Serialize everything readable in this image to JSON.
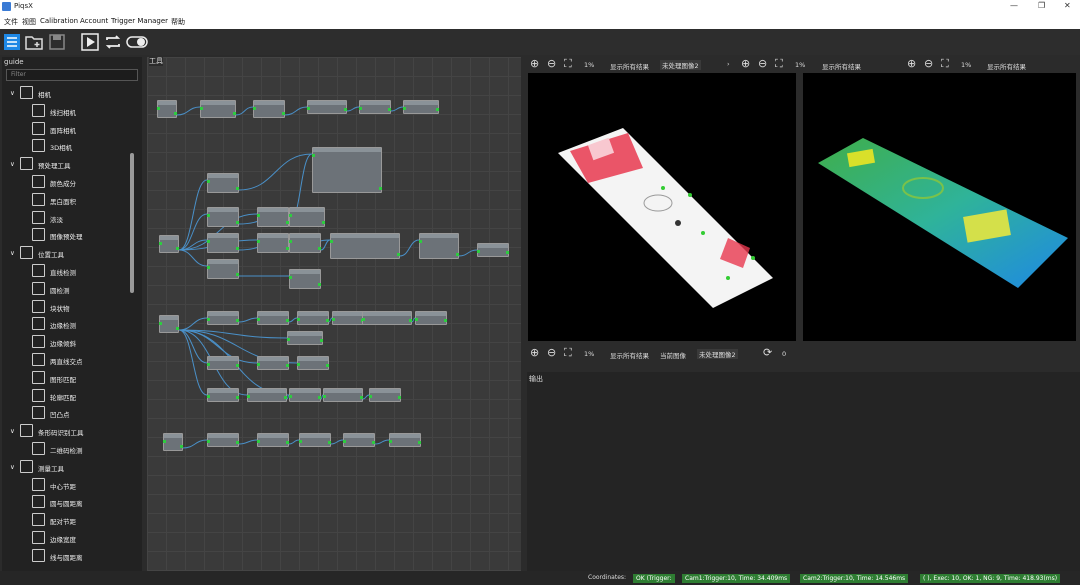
{
  "app": {
    "title": "PiqsX"
  },
  "window": {
    "minimize": "—",
    "maximize": "❐",
    "close": "✕"
  },
  "menu": [
    "文件",
    "视图",
    "Calibration",
    "Account",
    "Trigger Manager",
    "帮助"
  ],
  "left": {
    "header": "guide",
    "filter_placeholder": "Filter",
    "tree": [
      {
        "label": "相机",
        "level": 0
      },
      {
        "label": "线扫相机",
        "level": 1
      },
      {
        "label": "面阵相机",
        "level": 1
      },
      {
        "label": "3D相机",
        "level": 1
      },
      {
        "label": "预处理工具",
        "level": 0
      },
      {
        "label": "颜色成分",
        "level": 1
      },
      {
        "label": "黑白面积",
        "level": 1
      },
      {
        "label": "浓淡",
        "level": 1
      },
      {
        "label": "图像预处理",
        "level": 1
      },
      {
        "label": "位置工具",
        "level": 0
      },
      {
        "label": "直线检测",
        "level": 1
      },
      {
        "label": "圆检测",
        "level": 1
      },
      {
        "label": "块状物",
        "level": 1
      },
      {
        "label": "边缘检测",
        "level": 1
      },
      {
        "label": "边缘倾斜",
        "level": 1
      },
      {
        "label": "两直线交点",
        "level": 1
      },
      {
        "label": "图形匹配",
        "level": 1
      },
      {
        "label": "轮廓匹配",
        "level": 1
      },
      {
        "label": "凹凸点",
        "level": 1
      },
      {
        "label": "条形码识别工具",
        "level": 0
      },
      {
        "label": "二维码检测",
        "level": 1
      },
      {
        "label": "测量工具",
        "level": 0
      },
      {
        "label": "中心节距",
        "level": 1
      },
      {
        "label": "圆与圆距离",
        "level": 1
      },
      {
        "label": "配对节距",
        "level": 1
      },
      {
        "label": "边缘宽度",
        "level": 1
      },
      {
        "label": "线与圆距离",
        "level": 1
      }
    ]
  },
  "graph": {
    "header": "工具"
  },
  "viewer": {
    "zoom1": "1%",
    "show_all": "显示所有结果",
    "unproc": "未处理图像2",
    "current": "当前图像",
    "zoom_bottom": "1%",
    "count": "0"
  },
  "output": {
    "header": "输出"
  },
  "status": {
    "label": "Coordinates:",
    "items": [
      "OK (Trigger: ",
      "Cam1:Trigger:10, Time: 34.409ms ",
      "Cam2:Trigger:10, Time: 14.546ms ",
      "( ), Exec: 10, OK: 1, NG: 9, Time: 418.93(ms)"
    ]
  },
  "colors": {
    "accent": "#2e7d32",
    "port": "#2ecc40"
  }
}
